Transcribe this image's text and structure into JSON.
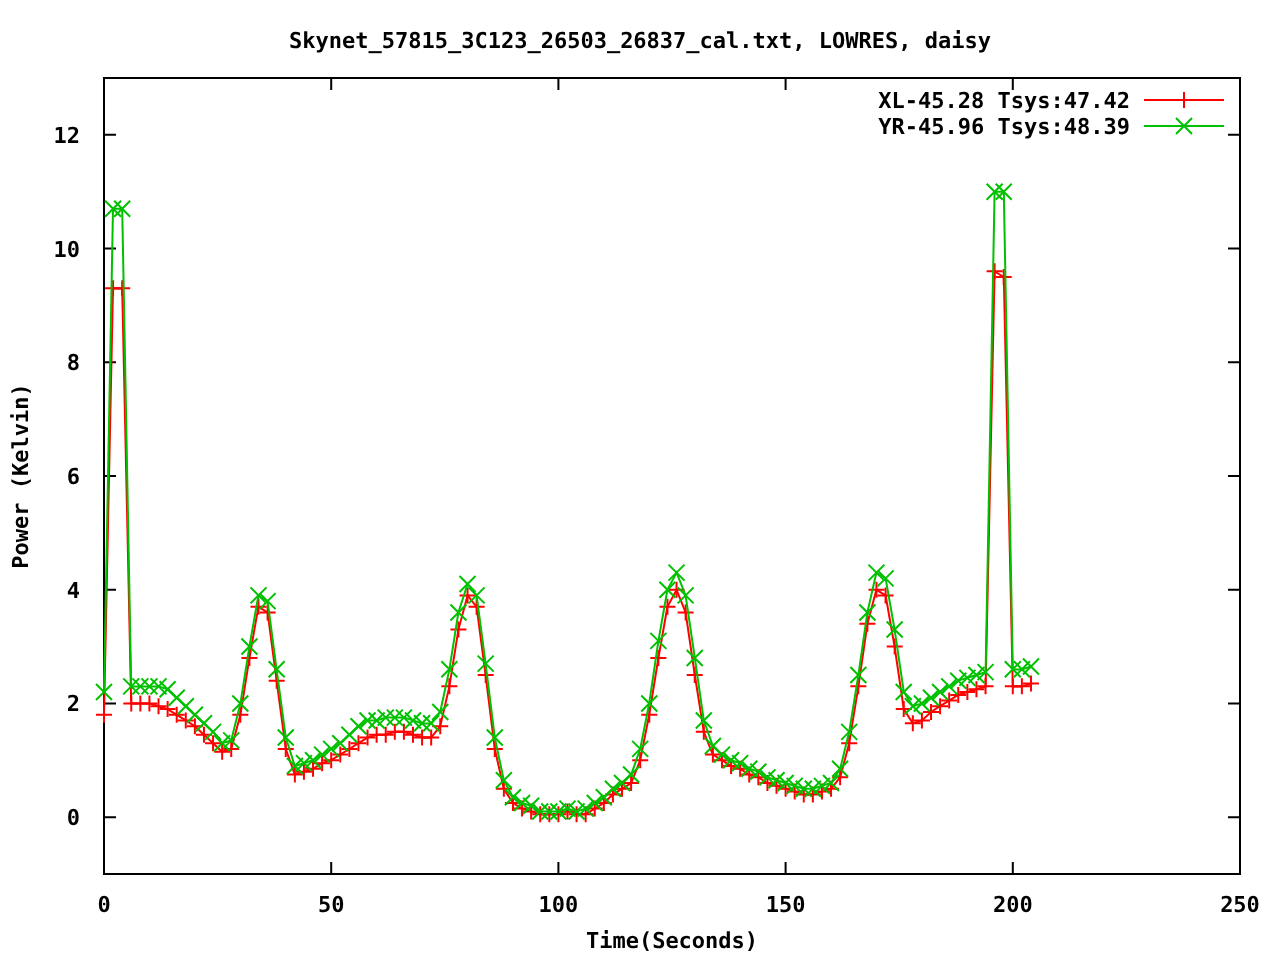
{
  "chart_data": {
    "type": "line",
    "title": "Skynet_57815_3C123_26503_26837_cal.txt, LOWRES, daisy",
    "xlabel": "Time(Seconds)",
    "ylabel": "Power (Kelvin)",
    "x": [
      0,
      2,
      4,
      6,
      8,
      10,
      12,
      14,
      16,
      18,
      20,
      22,
      24,
      26,
      28,
      30,
      32,
      34,
      36,
      38,
      40,
      42,
      44,
      46,
      48,
      50,
      52,
      54,
      56,
      58,
      60,
      62,
      64,
      66,
      68,
      70,
      72,
      74,
      76,
      78,
      80,
      82,
      84,
      86,
      88,
      90,
      92,
      94,
      96,
      98,
      100,
      102,
      104,
      106,
      108,
      110,
      112,
      114,
      116,
      118,
      120,
      122,
      124,
      126,
      128,
      130,
      132,
      134,
      136,
      138,
      140,
      142,
      144,
      146,
      148,
      150,
      152,
      154,
      156,
      158,
      160,
      162,
      164,
      166,
      168,
      170,
      172,
      174,
      176,
      178,
      180,
      182,
      184,
      186,
      188,
      190,
      192,
      194,
      196,
      198,
      200,
      202,
      204
    ],
    "series": [
      {
        "name": "XL-45.28 Tsys:47.42",
        "color": "#ff0000",
        "marker": "plus",
        "values": [
          1.8,
          9.3,
          9.3,
          2.0,
          2.0,
          2.0,
          1.95,
          1.9,
          1.8,
          1.7,
          1.6,
          1.45,
          1.3,
          1.15,
          1.2,
          1.8,
          2.8,
          3.7,
          3.6,
          2.4,
          1.2,
          0.75,
          0.8,
          0.85,
          0.95,
          1.0,
          1.1,
          1.2,
          1.3,
          1.4,
          1.45,
          1.45,
          1.5,
          1.5,
          1.45,
          1.4,
          1.4,
          1.6,
          2.3,
          3.3,
          3.9,
          3.7,
          2.5,
          1.2,
          0.5,
          0.25,
          0.15,
          0.1,
          0.05,
          0.05,
          0.05,
          0.1,
          0.05,
          0.05,
          0.15,
          0.25,
          0.4,
          0.5,
          0.6,
          1.0,
          1.8,
          2.8,
          3.7,
          4.0,
          3.6,
          2.5,
          1.5,
          1.1,
          1.0,
          0.9,
          0.85,
          0.75,
          0.7,
          0.6,
          0.55,
          0.5,
          0.45,
          0.4,
          0.4,
          0.45,
          0.5,
          0.7,
          1.3,
          2.3,
          3.4,
          4.0,
          3.9,
          3.0,
          1.9,
          1.65,
          1.7,
          1.85,
          1.95,
          2.05,
          2.15,
          2.2,
          2.25,
          2.3,
          9.6,
          9.5,
          2.3,
          2.3,
          2.35
        ]
      },
      {
        "name": "YR-45.96 Tsys:48.39",
        "color": "#00c000",
        "marker": "cross",
        "values": [
          2.2,
          10.7,
          10.7,
          2.3,
          2.3,
          2.3,
          2.3,
          2.25,
          2.1,
          1.95,
          1.8,
          1.65,
          1.5,
          1.3,
          1.35,
          2.0,
          3.0,
          3.9,
          3.8,
          2.6,
          1.4,
          0.9,
          0.95,
          1.0,
          1.1,
          1.2,
          1.3,
          1.45,
          1.6,
          1.7,
          1.7,
          1.75,
          1.75,
          1.75,
          1.7,
          1.65,
          1.65,
          1.85,
          2.6,
          3.6,
          4.1,
          3.9,
          2.7,
          1.4,
          0.65,
          0.35,
          0.25,
          0.2,
          0.1,
          0.1,
          0.1,
          0.15,
          0.1,
          0.15,
          0.25,
          0.35,
          0.5,
          0.6,
          0.75,
          1.2,
          2.0,
          3.1,
          4.0,
          4.3,
          3.9,
          2.8,
          1.7,
          1.25,
          1.1,
          1.0,
          0.95,
          0.85,
          0.8,
          0.7,
          0.65,
          0.6,
          0.55,
          0.5,
          0.5,
          0.55,
          0.6,
          0.85,
          1.5,
          2.5,
          3.6,
          4.3,
          4.2,
          3.3,
          2.2,
          1.95,
          2.0,
          2.1,
          2.2,
          2.3,
          2.4,
          2.45,
          2.5,
          2.55,
          11.0,
          11.0,
          2.6,
          2.6,
          2.65
        ]
      }
    ],
    "legend": true,
    "xlim": [
      0,
      250
    ],
    "ylim": [
      -1,
      13
    ],
    "xticks": [
      0,
      50,
      100,
      150,
      200,
      250
    ],
    "yticks": [
      0,
      2,
      4,
      6,
      8,
      10,
      12
    ]
  }
}
